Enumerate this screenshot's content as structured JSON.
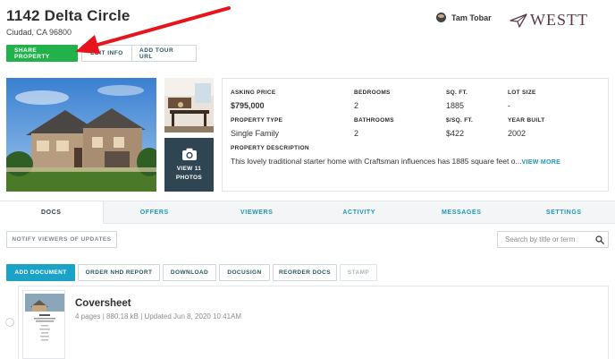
{
  "property": {
    "address": "1142 Delta Circle",
    "city_line": "Ciudad, CA 96800"
  },
  "header_buttons": {
    "share": "SHARE PROPERTY",
    "edit": "EDIT INFO",
    "tour": "ADD TOUR URL"
  },
  "user": {
    "name": "Tam Tobar"
  },
  "brand": {
    "logo_text": "WESTT"
  },
  "photos": {
    "view_label_line1": "VIEW 11",
    "view_label_line2": "PHOTOS"
  },
  "details": {
    "asking_price": {
      "label": "ASKING PRICE",
      "value": "$795,000"
    },
    "bedrooms": {
      "label": "BEDROOMS",
      "value": "2"
    },
    "sqft": {
      "label": "SQ. FT.",
      "value": "1885"
    },
    "lot_size": {
      "label": "LOT SIZE",
      "value": "-"
    },
    "property_type": {
      "label": "PROPERTY TYPE",
      "value": "Single Family"
    },
    "bathrooms": {
      "label": "BATHROOMS",
      "value": "2"
    },
    "price_per_sqft": {
      "label": "$/SQ. FT.",
      "value": "$422"
    },
    "year_built": {
      "label": "YEAR BUILT",
      "value": "2002"
    },
    "description": {
      "label": "PROPERTY DESCRIPTION",
      "text": "This lovely traditional starter home with Craftsman influences has 1885 square feet o...",
      "more": "VIEW MORE"
    }
  },
  "tabs": [
    {
      "label": "DOCS",
      "active": true
    },
    {
      "label": "OFFERS",
      "active": false
    },
    {
      "label": "VIEWERS",
      "active": false
    },
    {
      "label": "ACTIVITY",
      "active": false
    },
    {
      "label": "MESSAGES",
      "active": false
    },
    {
      "label": "SETTINGS",
      "active": false
    }
  ],
  "docs_toolbar": {
    "notify": "NOTIFY VIEWERS OF UPDATES",
    "search_placeholder": "Search by title or term"
  },
  "doc_actions": {
    "add": "ADD DOCUMENT",
    "nhd": "ORDER NHD REPORT",
    "download": "DOWNLOAD",
    "docusign": "DOCUSIGN",
    "reorder": "REORDER DOCS",
    "stamp": "STAMP"
  },
  "documents": [
    {
      "title": "Coversheet",
      "meta": "4 pages | 880.18 kB | Updated Jun 8, 2020 10:41AM"
    }
  ],
  "colors": {
    "share_green": "#22b24c",
    "accent_blue": "#1aa3c6",
    "tab_text": "#1c97b8",
    "photo_overlay": "#2f4652",
    "annotation_arrow": "#e8141b"
  }
}
